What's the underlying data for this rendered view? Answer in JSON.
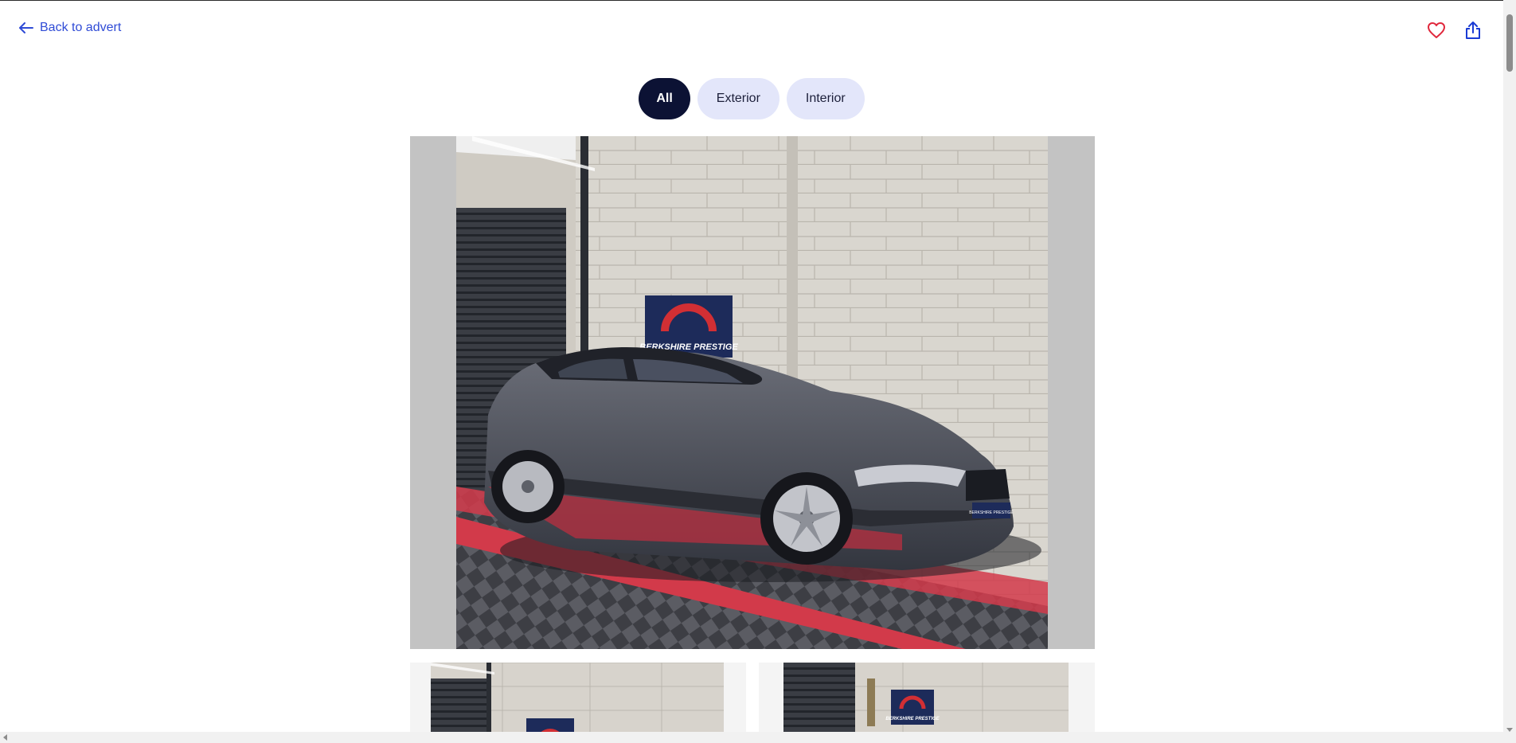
{
  "nav": {
    "back_label": "Back to advert"
  },
  "actions": {
    "favourite_icon": "heart-icon",
    "share_icon": "share-icon"
  },
  "filters": [
    {
      "label": "All",
      "active": true
    },
    {
      "label": "Exterior",
      "active": false
    },
    {
      "label": "Interior",
      "active": false
    }
  ],
  "photo": {
    "sign_text": "BERKSHIRE PRESTIGE",
    "plate_text": "BERKSHIRE PRESTIGE"
  },
  "thumbnails": {
    "right_sign_text": "BERKSHIRE PRESTIGE"
  },
  "colors": {
    "link": "#2f4bd6",
    "pill_active_bg": "#0c1234",
    "pill_bg": "#e3e6fa",
    "heart": "#e0283c",
    "share": "#1a3bd4"
  }
}
